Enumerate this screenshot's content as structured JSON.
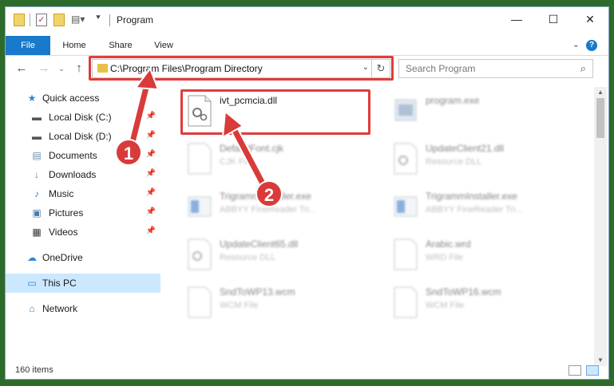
{
  "window": {
    "title": "Program",
    "controls": {
      "minimize": "—",
      "maximize": "☐",
      "close": "✕"
    }
  },
  "ribbon": {
    "tabs": [
      "File",
      "Home",
      "Share",
      "View"
    ],
    "help": "?"
  },
  "nav": {
    "address": "C:\\Program Files\\Program Directory",
    "search_placeholder": "Search Program"
  },
  "sidebar": {
    "items": [
      {
        "label": "Quick access",
        "icon": "star-icon"
      },
      {
        "label": "Local Disk (C:)",
        "icon": "drive-icon",
        "pinned": true
      },
      {
        "label": "Local Disk (D:)",
        "icon": "drive-icon",
        "pinned": true
      },
      {
        "label": "Documents",
        "icon": "documents-icon",
        "pinned": true
      },
      {
        "label": "Downloads",
        "icon": "download-icon",
        "pinned": true
      },
      {
        "label": "Music",
        "icon": "music-icon",
        "pinned": true
      },
      {
        "label": "Pictures",
        "icon": "pictures-icon",
        "pinned": true
      },
      {
        "label": "Videos",
        "icon": "videos-icon",
        "pinned": true
      },
      {
        "label": "OneDrive",
        "icon": "cloud-icon"
      },
      {
        "label": "This PC",
        "icon": "computer-icon",
        "selected": true
      },
      {
        "label": "Network",
        "icon": "network-icon"
      }
    ]
  },
  "files": [
    {
      "name": "ivt_pcmcia.dll",
      "type": ""
    },
    {
      "name": "program.exe",
      "type": ""
    },
    {
      "name": "DefaultFont.cjk",
      "type": "CJK File"
    },
    {
      "name": "UpdateClient21.dll",
      "type": "Resource DLL"
    },
    {
      "name": "TrigrammInstaller.exe",
      "type": "ABBYY FineReader Tri..."
    },
    {
      "name": "TrigrammInstaller.exe",
      "type": "ABBYY FineReader Tri..."
    },
    {
      "name": "UpdateClient65.dll",
      "type": "Resource DLL"
    },
    {
      "name": "Arabic.wrd",
      "type": "WRD File"
    },
    {
      "name": "SndToWP13.wcm",
      "type": "WCM File"
    },
    {
      "name": "SndToWP16.wcm",
      "type": "WCM File"
    }
  ],
  "status": {
    "items": "160 items"
  },
  "annotations": {
    "step1": "1",
    "step2": "2"
  },
  "colors": {
    "accent": "#1979ca",
    "annotation": "#e03c3c",
    "folder": "#e8c048"
  }
}
